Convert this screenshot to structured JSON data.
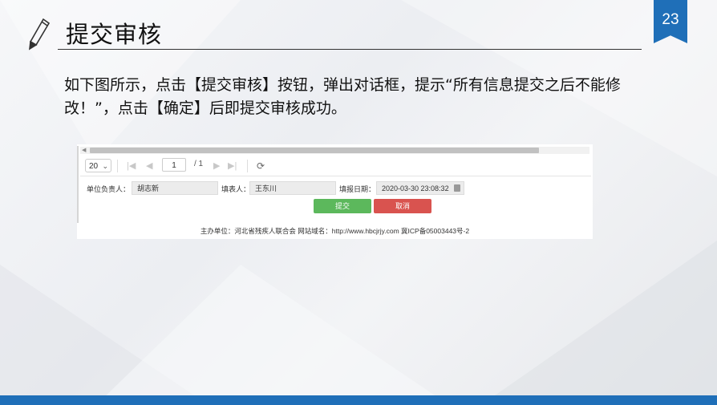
{
  "slide": {
    "page_number": "23",
    "title": "提交审核",
    "body": "如下图所示，点击【提交审核】按钮，弹出对话框，提示“所有信息提交之后不能修改！”，点击【确定】后即提交审核成功。"
  },
  "screenshot": {
    "pager": {
      "page_size": "20",
      "current_page": "1",
      "total_pages": "/ 1"
    },
    "form": {
      "unit_head_label": "单位负责人：",
      "unit_head_value": "胡志新",
      "filler_label": "填表人：",
      "filler_value": "王东川",
      "date_label": "填报日期：",
      "date_value": "2020-03-30 23:08:32"
    },
    "buttons": {
      "submit": "提交",
      "cancel": "取消"
    },
    "footer": "主办单位：河北省残疾人联合会 网站域名：http://www.hbcjrjy.com 冀ICP备05003443号-2"
  },
  "colors": {
    "accent": "#1f6fb8",
    "submit": "#5cb85c",
    "cancel": "#d9534f"
  },
  "icons": [
    "pencil-icon",
    "chevron-down-icon",
    "first-page-icon",
    "prev-page-icon",
    "next-page-icon",
    "last-page-icon",
    "refresh-icon",
    "calendar-icon"
  ]
}
